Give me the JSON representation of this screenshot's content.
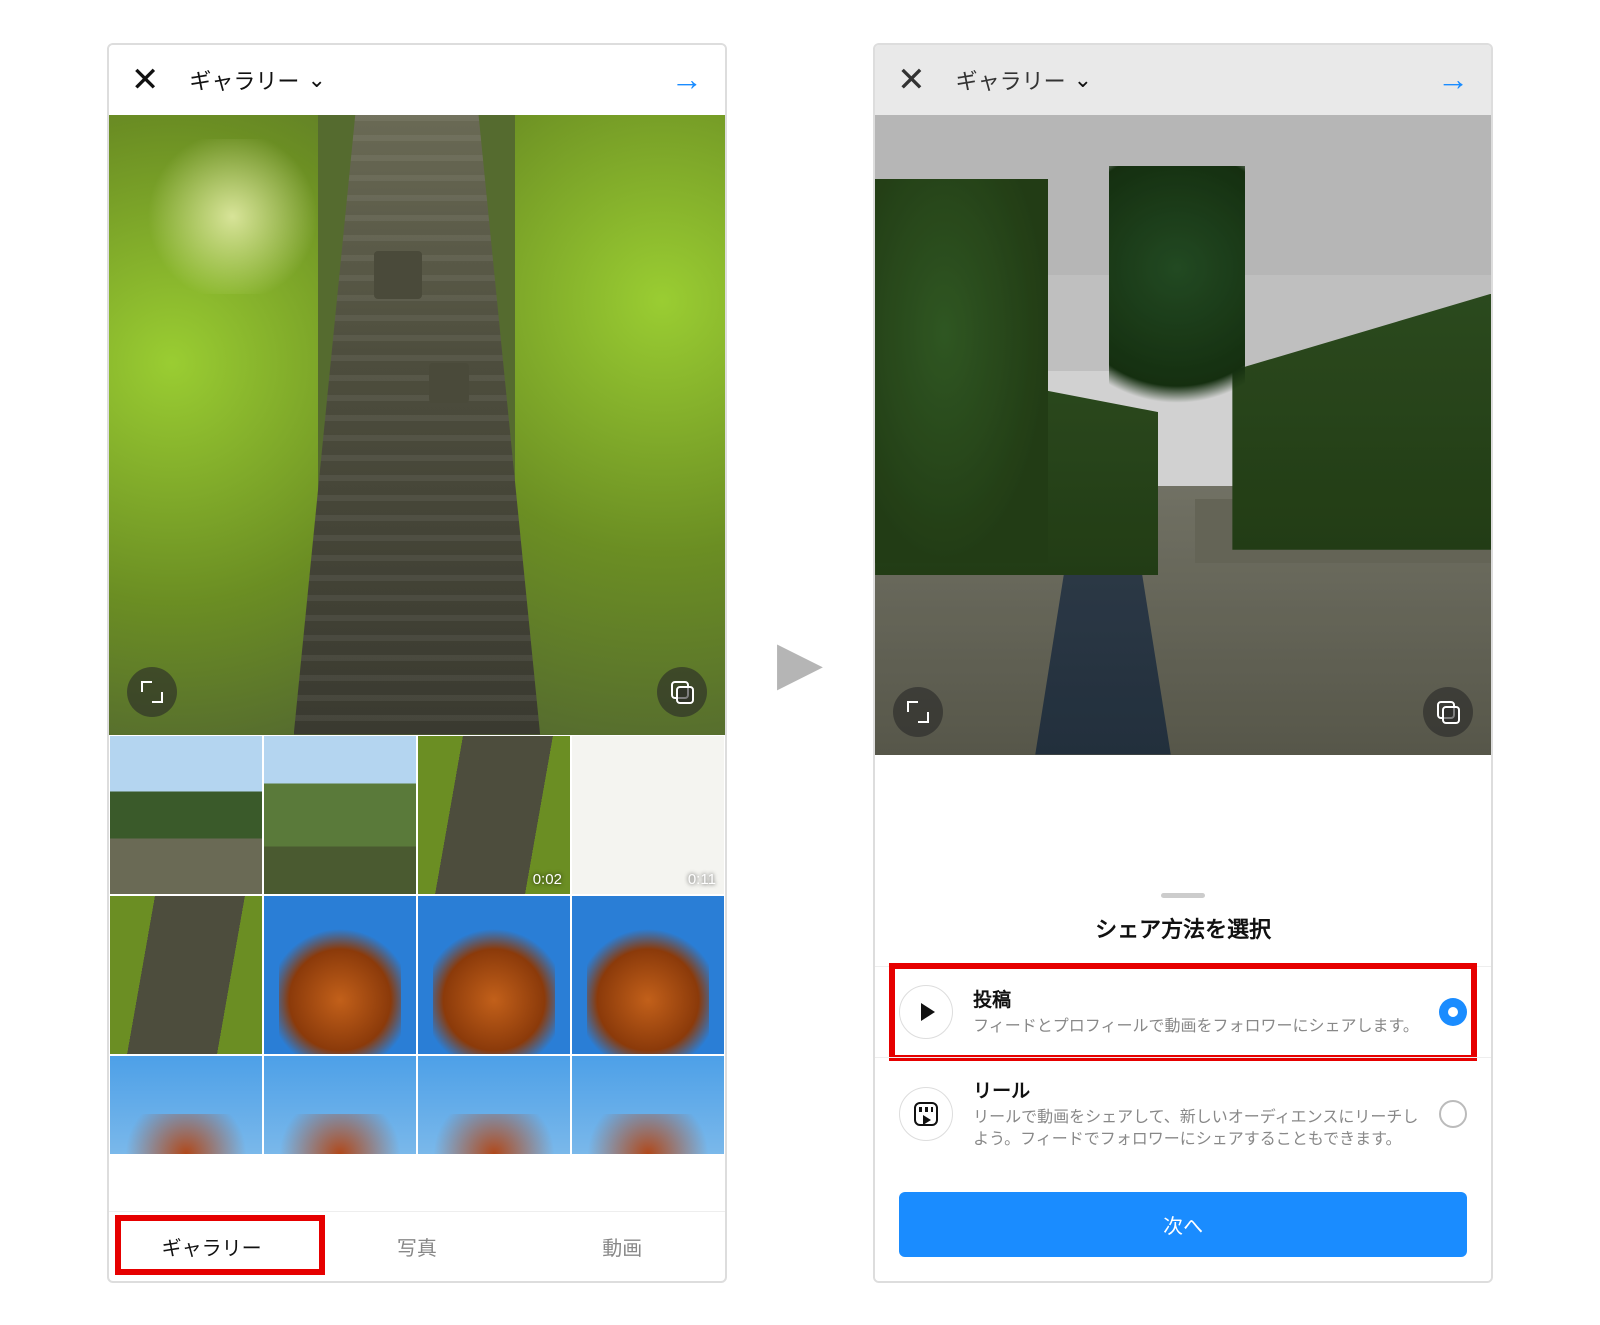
{
  "left": {
    "topbar": {
      "title": "ギャラリー"
    },
    "preview_buttons": {
      "expand": "expand-icon",
      "multi": "multi-select-icon"
    },
    "thumbs": {
      "row1": [
        {
          "kind": "path"
        },
        {
          "kind": "garden"
        },
        {
          "kind": "stream",
          "duration": "0:02"
        },
        {
          "kind": "white",
          "duration": "0:11"
        }
      ],
      "row2": [
        {
          "kind": "stream"
        },
        {
          "kind": "tree"
        },
        {
          "kind": "tree"
        },
        {
          "kind": "tree"
        }
      ],
      "row3": [
        {
          "kind": "sky"
        },
        {
          "kind": "sky"
        },
        {
          "kind": "sky"
        },
        {
          "kind": "sky"
        }
      ]
    },
    "tabs": {
      "gallery": "ギャラリー",
      "photos": "写真",
      "videos": "動画",
      "active": "gallery"
    }
  },
  "right": {
    "topbar": {
      "title": "ギャラリー"
    },
    "sheet": {
      "title": "シェア方法を選択",
      "options": [
        {
          "key": "post",
          "title": "投稿",
          "desc": "フィードとプロフィールで動画をフォロワーにシェアします。",
          "selected": true,
          "highlighted": true
        },
        {
          "key": "reel",
          "title": "リール",
          "desc": "リールで動画をシェアして、新しいオーディエンスにリーチしよう。フィードでフォロワーにシェアすることもできます。",
          "selected": false,
          "highlighted": false
        }
      ],
      "next_button": "次へ"
    }
  }
}
